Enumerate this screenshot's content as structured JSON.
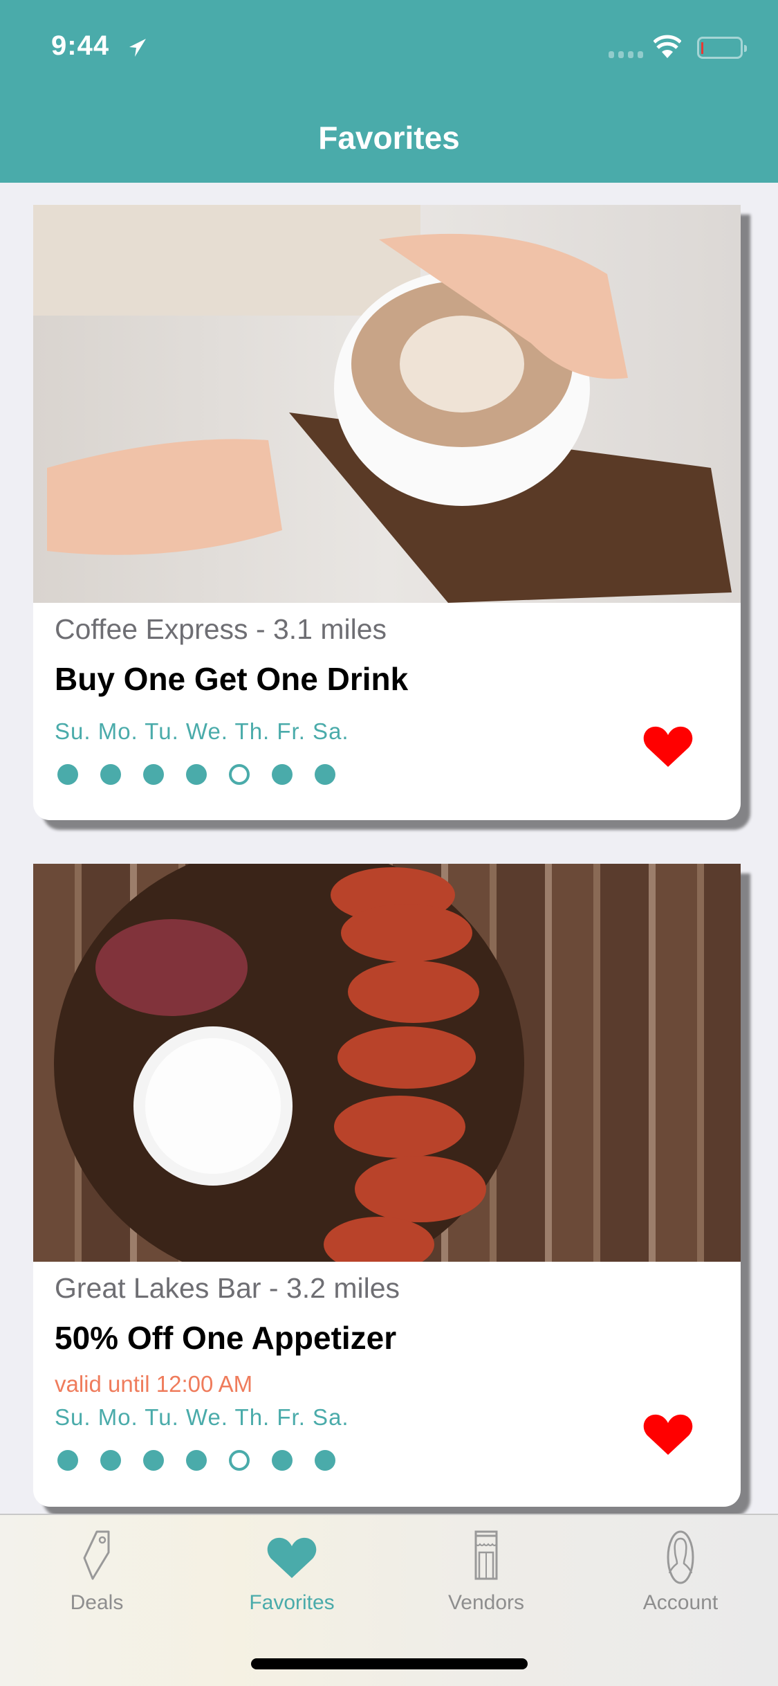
{
  "status": {
    "time": "9:44"
  },
  "header": {
    "title": "Favorites"
  },
  "cards": [
    {
      "vendor": "Coffee Express - 3.1 miles",
      "deal": "Buy One Get One Drink",
      "days": "Su. Mo. Tu. We. Th. Fr. Sa.",
      "active_days": [
        true,
        true,
        true,
        true,
        false,
        true,
        true
      ],
      "favorited": true
    },
    {
      "vendor": "Great Lakes Bar - 3.2 miles",
      "deal": "50% Off One Appetizer",
      "valid": "valid until 12:00 AM",
      "days": "Su. Mo. Tu. We. Th. Fr. Sa.",
      "active_days": [
        true,
        true,
        true,
        true,
        false,
        true,
        true
      ],
      "favorited": true
    }
  ],
  "tabs": [
    {
      "label": "Deals"
    },
    {
      "label": "Favorites"
    },
    {
      "label": "Vendors"
    },
    {
      "label": "Account"
    }
  ],
  "colors": {
    "accent": "#4aabaa",
    "heart": "#ff0000",
    "valid": "#ef7c5c"
  }
}
